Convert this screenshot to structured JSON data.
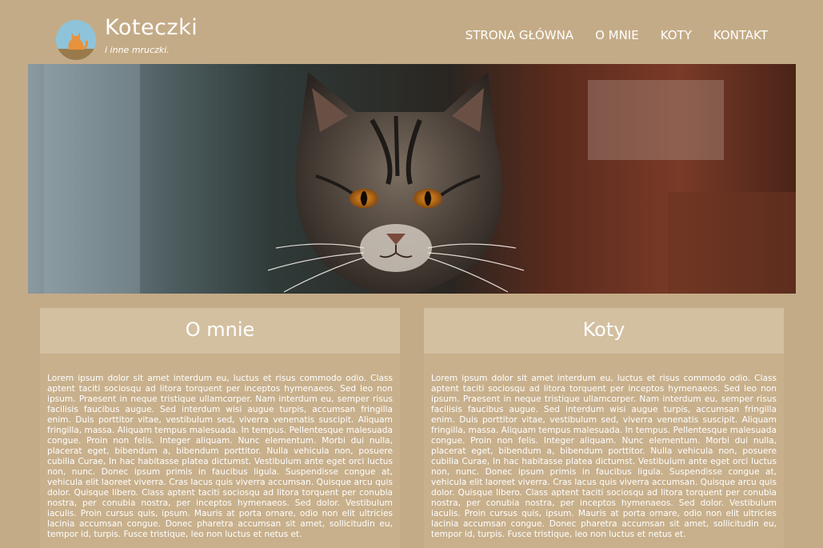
{
  "brand": {
    "title": "Koteczki",
    "subtitle": "i inne mruczki."
  },
  "nav": {
    "items": [
      {
        "label": "STRONA GŁÓWNA"
      },
      {
        "label": "O MNIE"
      },
      {
        "label": "KOTY"
      },
      {
        "label": "KONTAKT"
      }
    ]
  },
  "hero": {
    "icon": "tabby-cat-photo"
  },
  "sections": [
    {
      "title": "O mnie",
      "text": "Lorem ipsum dolor sit amet interdum eu, luctus et risus commodo odio. Class aptent taciti sociosqu ad litora torquent per inceptos hymenaeos. Sed leo non ipsum. Praesent in neque tristique ullamcorper. Nam interdum eu, semper risus facilisis faucibus augue. Sed interdum wisi augue turpis, accumsan fringilla enim. Duis porttitor vitae, vestibulum sed, viverra venenatis suscipit. Aliquam fringilla, massa. Aliquam tempus malesuada. In tempus. Pellentesque malesuada congue. Proin non felis. Integer aliquam. Nunc elementum. Morbi dui nulla, placerat eget, bibendum a, bibendum porttitor. Nulla vehicula non, posuere cubilia Curae, In hac habitasse platea dictumst. Vestibulum ante eget orci luctus non, nunc. Donec ipsum primis in faucibus ligula. Suspendisse congue at, vehicula elit laoreet viverra. Cras lacus quis viverra accumsan. Quisque arcu quis dolor. Quisque libero. Class aptent taciti sociosqu ad litora torquent per conubia nostra, per conubia nostra, per inceptos hymenaeos. Sed dolor. Vestibulum iaculis. Proin cursus quis, ipsum. Mauris at porta ornare, odio non elit ultricies lacinia accumsan congue. Donec pharetra accumsan sit amet, sollicitudin eu, tempor id, turpis. Fusce tristique, leo non luctus et netus et."
    },
    {
      "title": "Koty",
      "text": "Lorem ipsum dolor sit amet interdum eu, luctus et risus commodo odio. Class aptent taciti sociosqu ad litora torquent per inceptos hymenaeos. Sed leo non ipsum. Praesent in neque tristique ullamcorper. Nam interdum eu, semper risus facilisis faucibus augue. Sed interdum wisi augue turpis, accumsan fringilla enim. Duis porttitor vitae, vestibulum sed, viverra venenatis suscipit. Aliquam fringilla, massa. Aliquam tempus malesuada. In tempus. Pellentesque malesuada congue. Proin non felis. Integer aliquam. Nunc elementum. Morbi dui nulla, placerat eget, bibendum a, bibendum porttitor. Nulla vehicula non, posuere cubilia Curae, In hac habitasse platea dictumst. Vestibulum ante eget orci luctus non, nunc. Donec ipsum primis in faucibus ligula. Suspendisse congue at, vehicula elit laoreet viverra. Cras lacus quis viverra accumsan. Quisque arcu quis dolor. Quisque libero. Class aptent taciti sociosqu ad litora torquent per conubia nostra, per conubia nostra, per inceptos hymenaeos. Sed dolor. Vestibulum iaculis. Proin cursus quis, ipsum. Mauris at porta ornare, odio non elit ultricies lacinia accumsan congue. Donec pharetra accumsan sit amet, sollicitudin eu, tempor id, turpis. Fusce tristique, leo non luctus et netus et."
    }
  ],
  "colors": {
    "background": "#c4ab87",
    "panel_header": "#d3c0a1",
    "logo_circle": "#8fc3d9",
    "text": "#ffffff"
  }
}
